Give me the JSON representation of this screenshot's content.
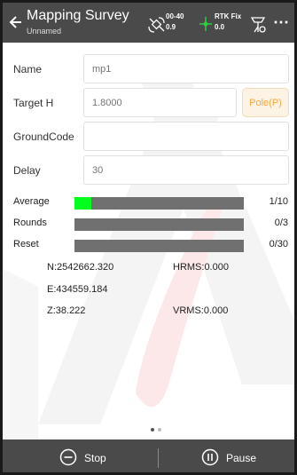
{
  "header": {
    "title": "Mapping Survey",
    "subtitle": "Unnamed",
    "satellite_top": "00-40",
    "satellite_bottom": "0.9",
    "rtk_top": "RTK Fix",
    "rtk_bottom": "0.0",
    "more_label": "⋯"
  },
  "form": {
    "name_label": "Name",
    "name_placeholder": "mp1",
    "target_label": "Target H",
    "target_placeholder": "1.8000",
    "pole_button": "Pole(P)",
    "ground_label": "GroundCode",
    "ground_value": "",
    "delay_label": "Delay",
    "delay_placeholder": "30"
  },
  "progress": [
    {
      "label": "Average",
      "count": "1/10",
      "fraction": 0.1
    },
    {
      "label": "Rounds",
      "count": "0/3",
      "fraction": 0
    },
    {
      "label": "Reset",
      "count": "0/30",
      "fraction": 0
    }
  ],
  "coords": {
    "n": "N:2542662.320",
    "hrms": "HRMS:0.000",
    "e": "E:434559.184",
    "z": "Z:38.222",
    "vrms": "VRMS:0.000"
  },
  "footer": {
    "stop_label": "Stop",
    "pause_label": "Pause"
  },
  "colors": {
    "header_bg": "#4a4a4a",
    "progress_fill": "#00ff1e",
    "accent_orange": "#f5a93d",
    "rtk_green": "#2ecc40"
  }
}
